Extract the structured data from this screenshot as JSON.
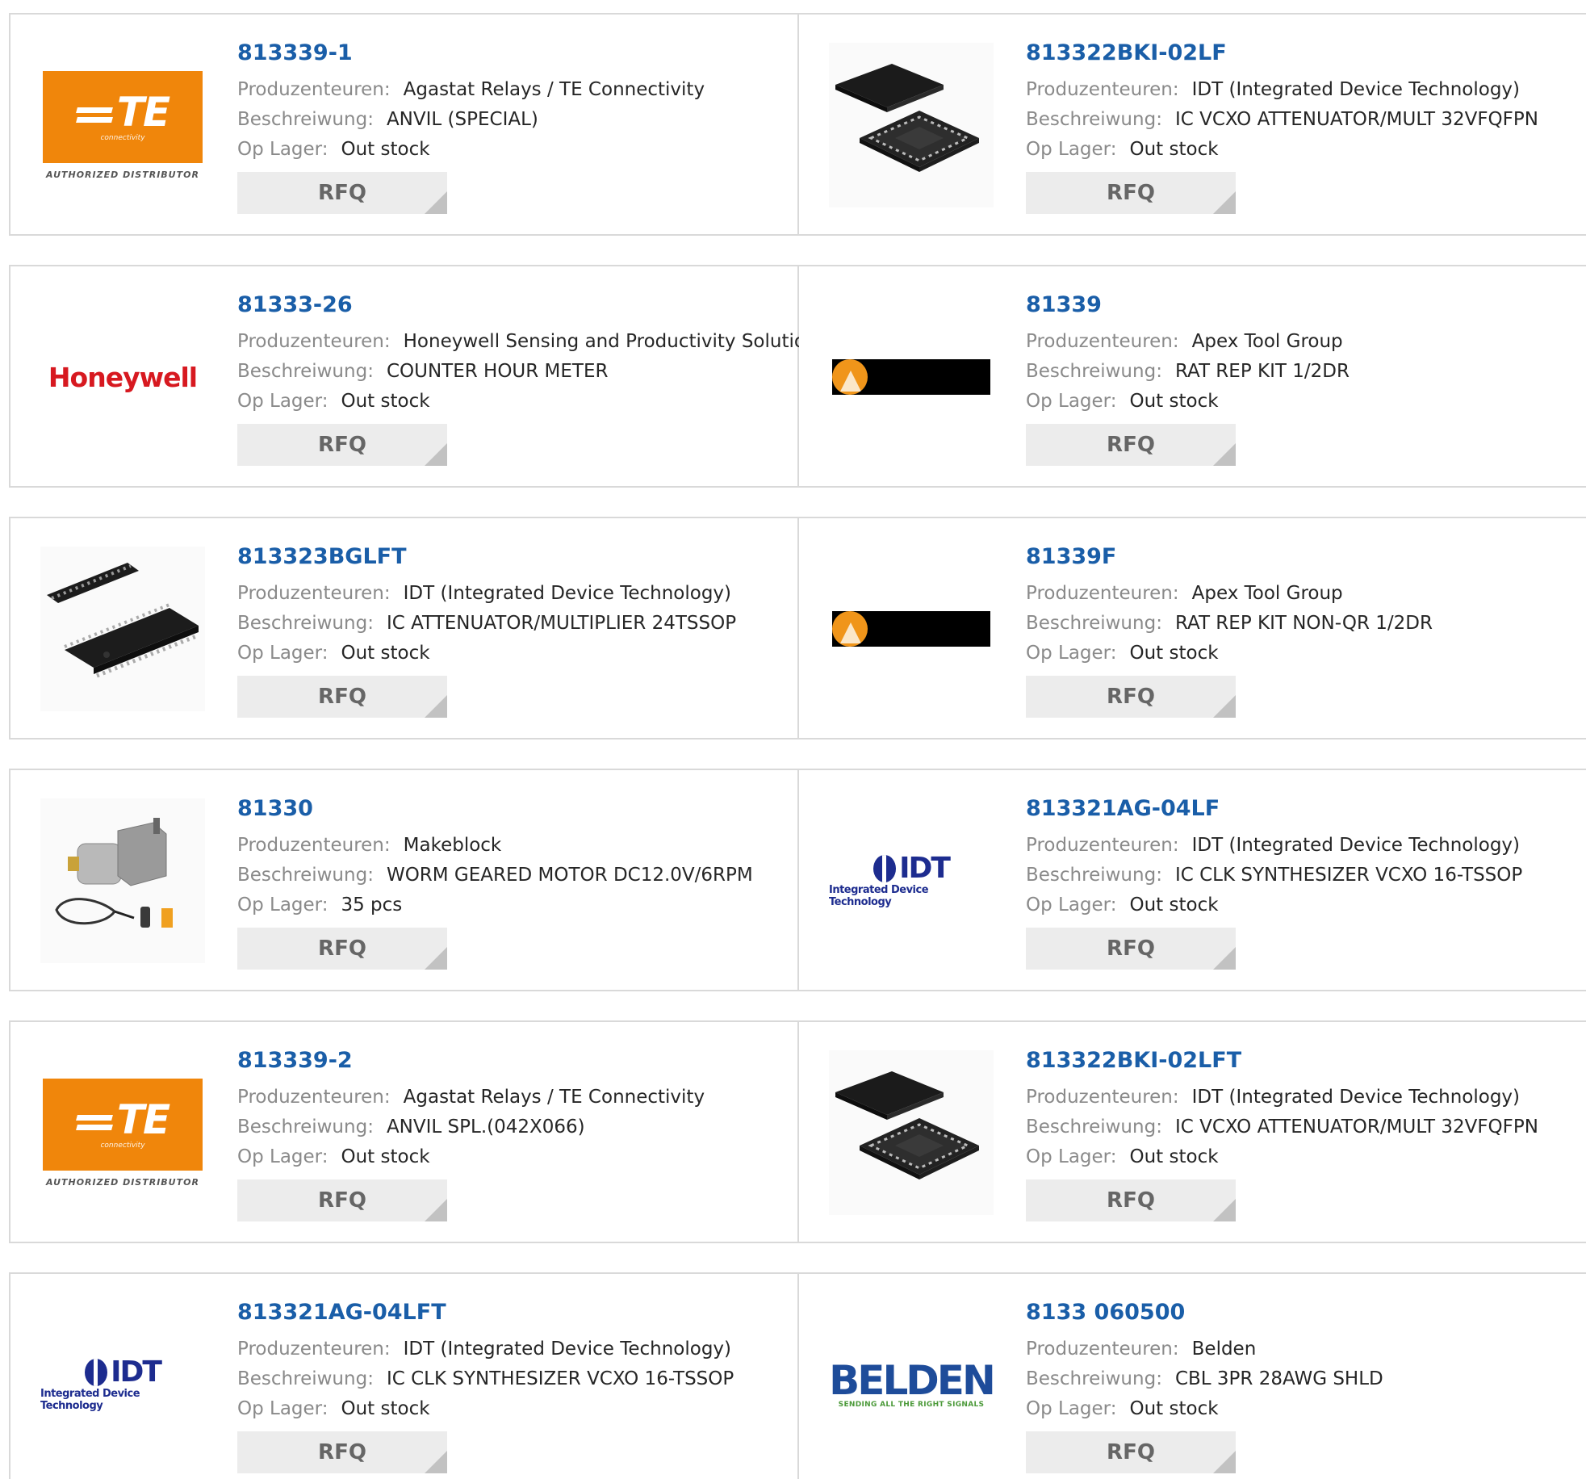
{
  "labels": {
    "manufacturer": "Produzenteuren:",
    "description": "Beschreiwung:",
    "stock": "Op Lager:",
    "rfq": "RFQ"
  },
  "colors": {
    "part_link": "#1a5ea8",
    "label_gray": "#8a8a8a",
    "rfq_bg": "#ececec",
    "border": "#d9d9d9"
  },
  "products": [
    {
      "part": "813339-1",
      "manufacturer": "Agastat Relays / TE Connectivity",
      "description": "ANVIL (SPECIAL)",
      "stock": "Out stock",
      "image": "te-connectivity-logo",
      "logo_text": "TE",
      "logo_sub": "connectivity",
      "logo_tag": "AUTHORIZED DISTRIBUTOR"
    },
    {
      "part": "813322BKI-02LF",
      "manufacturer": "IDT (Integrated Device Technology)",
      "description": "IC VCXO ATTENUATOR/MULT 32VFQFPN",
      "stock": "Out stock",
      "image": "qfn-chip-photo"
    },
    {
      "part": "81333-26",
      "manufacturer": "Honeywell Sensing and Productivity Solutions",
      "description": "COUNTER HOUR METER",
      "stock": "Out stock",
      "image": "honeywell-logo",
      "logo_text": "Honeywell"
    },
    {
      "part": "81339",
      "manufacturer": "Apex Tool Group",
      "description": "RAT REP KIT 1/2DR",
      "stock": "Out stock",
      "image": "apex-tool-logo"
    },
    {
      "part": "813323BGLFT",
      "manufacturer": "IDT (Integrated Device Technology)",
      "description": "IC ATTENUATOR/MULTIPLIER 24TSSOP",
      "stock": "Out stock",
      "image": "tssop-chip-photo"
    },
    {
      "part": "81339F",
      "manufacturer": "Apex Tool Group",
      "description": "RAT REP KIT NON-QR 1/2DR",
      "stock": "Out stock",
      "image": "apex-tool-logo"
    },
    {
      "part": "81330",
      "manufacturer": "Makeblock",
      "description": "WORM GEARED MOTOR DC12.0V/6RPM",
      "stock": "35 pcs",
      "image": "geared-motor-photo"
    },
    {
      "part": "813321AG-04LF",
      "manufacturer": "IDT (Integrated Device Technology)",
      "description": "IC CLK SYNTHESIZER VCXO 16-TSSOP",
      "stock": "Out stock",
      "image": "idt-logo",
      "logo_text": "IDT",
      "logo_sub": "Integrated Device Technology"
    },
    {
      "part": "813339-2",
      "manufacturer": "Agastat Relays / TE Connectivity",
      "description": "ANVIL SPL.(042X066)",
      "stock": "Out stock",
      "image": "te-connectivity-logo",
      "logo_text": "TE",
      "logo_sub": "connectivity",
      "logo_tag": "AUTHORIZED DISTRIBUTOR"
    },
    {
      "part": "813322BKI-02LFT",
      "manufacturer": "IDT (Integrated Device Technology)",
      "description": "IC VCXO ATTENUATOR/MULT 32VFQFPN",
      "stock": "Out stock",
      "image": "qfn-chip-photo"
    },
    {
      "part": "813321AG-04LFT",
      "manufacturer": "IDT (Integrated Device Technology)",
      "description": "IC CLK SYNTHESIZER VCXO 16-TSSOP",
      "stock": "Out stock",
      "image": "idt-logo",
      "logo_text": "IDT",
      "logo_sub": "Integrated Device Technology"
    },
    {
      "part": "8133 060500",
      "manufacturer": "Belden",
      "description": "CBL 3PR 28AWG SHLD",
      "stock": "Out stock",
      "image": "belden-logo",
      "logo_text": "BELDEN",
      "logo_sub": "SENDING ALL THE RIGHT SIGNALS"
    }
  ]
}
